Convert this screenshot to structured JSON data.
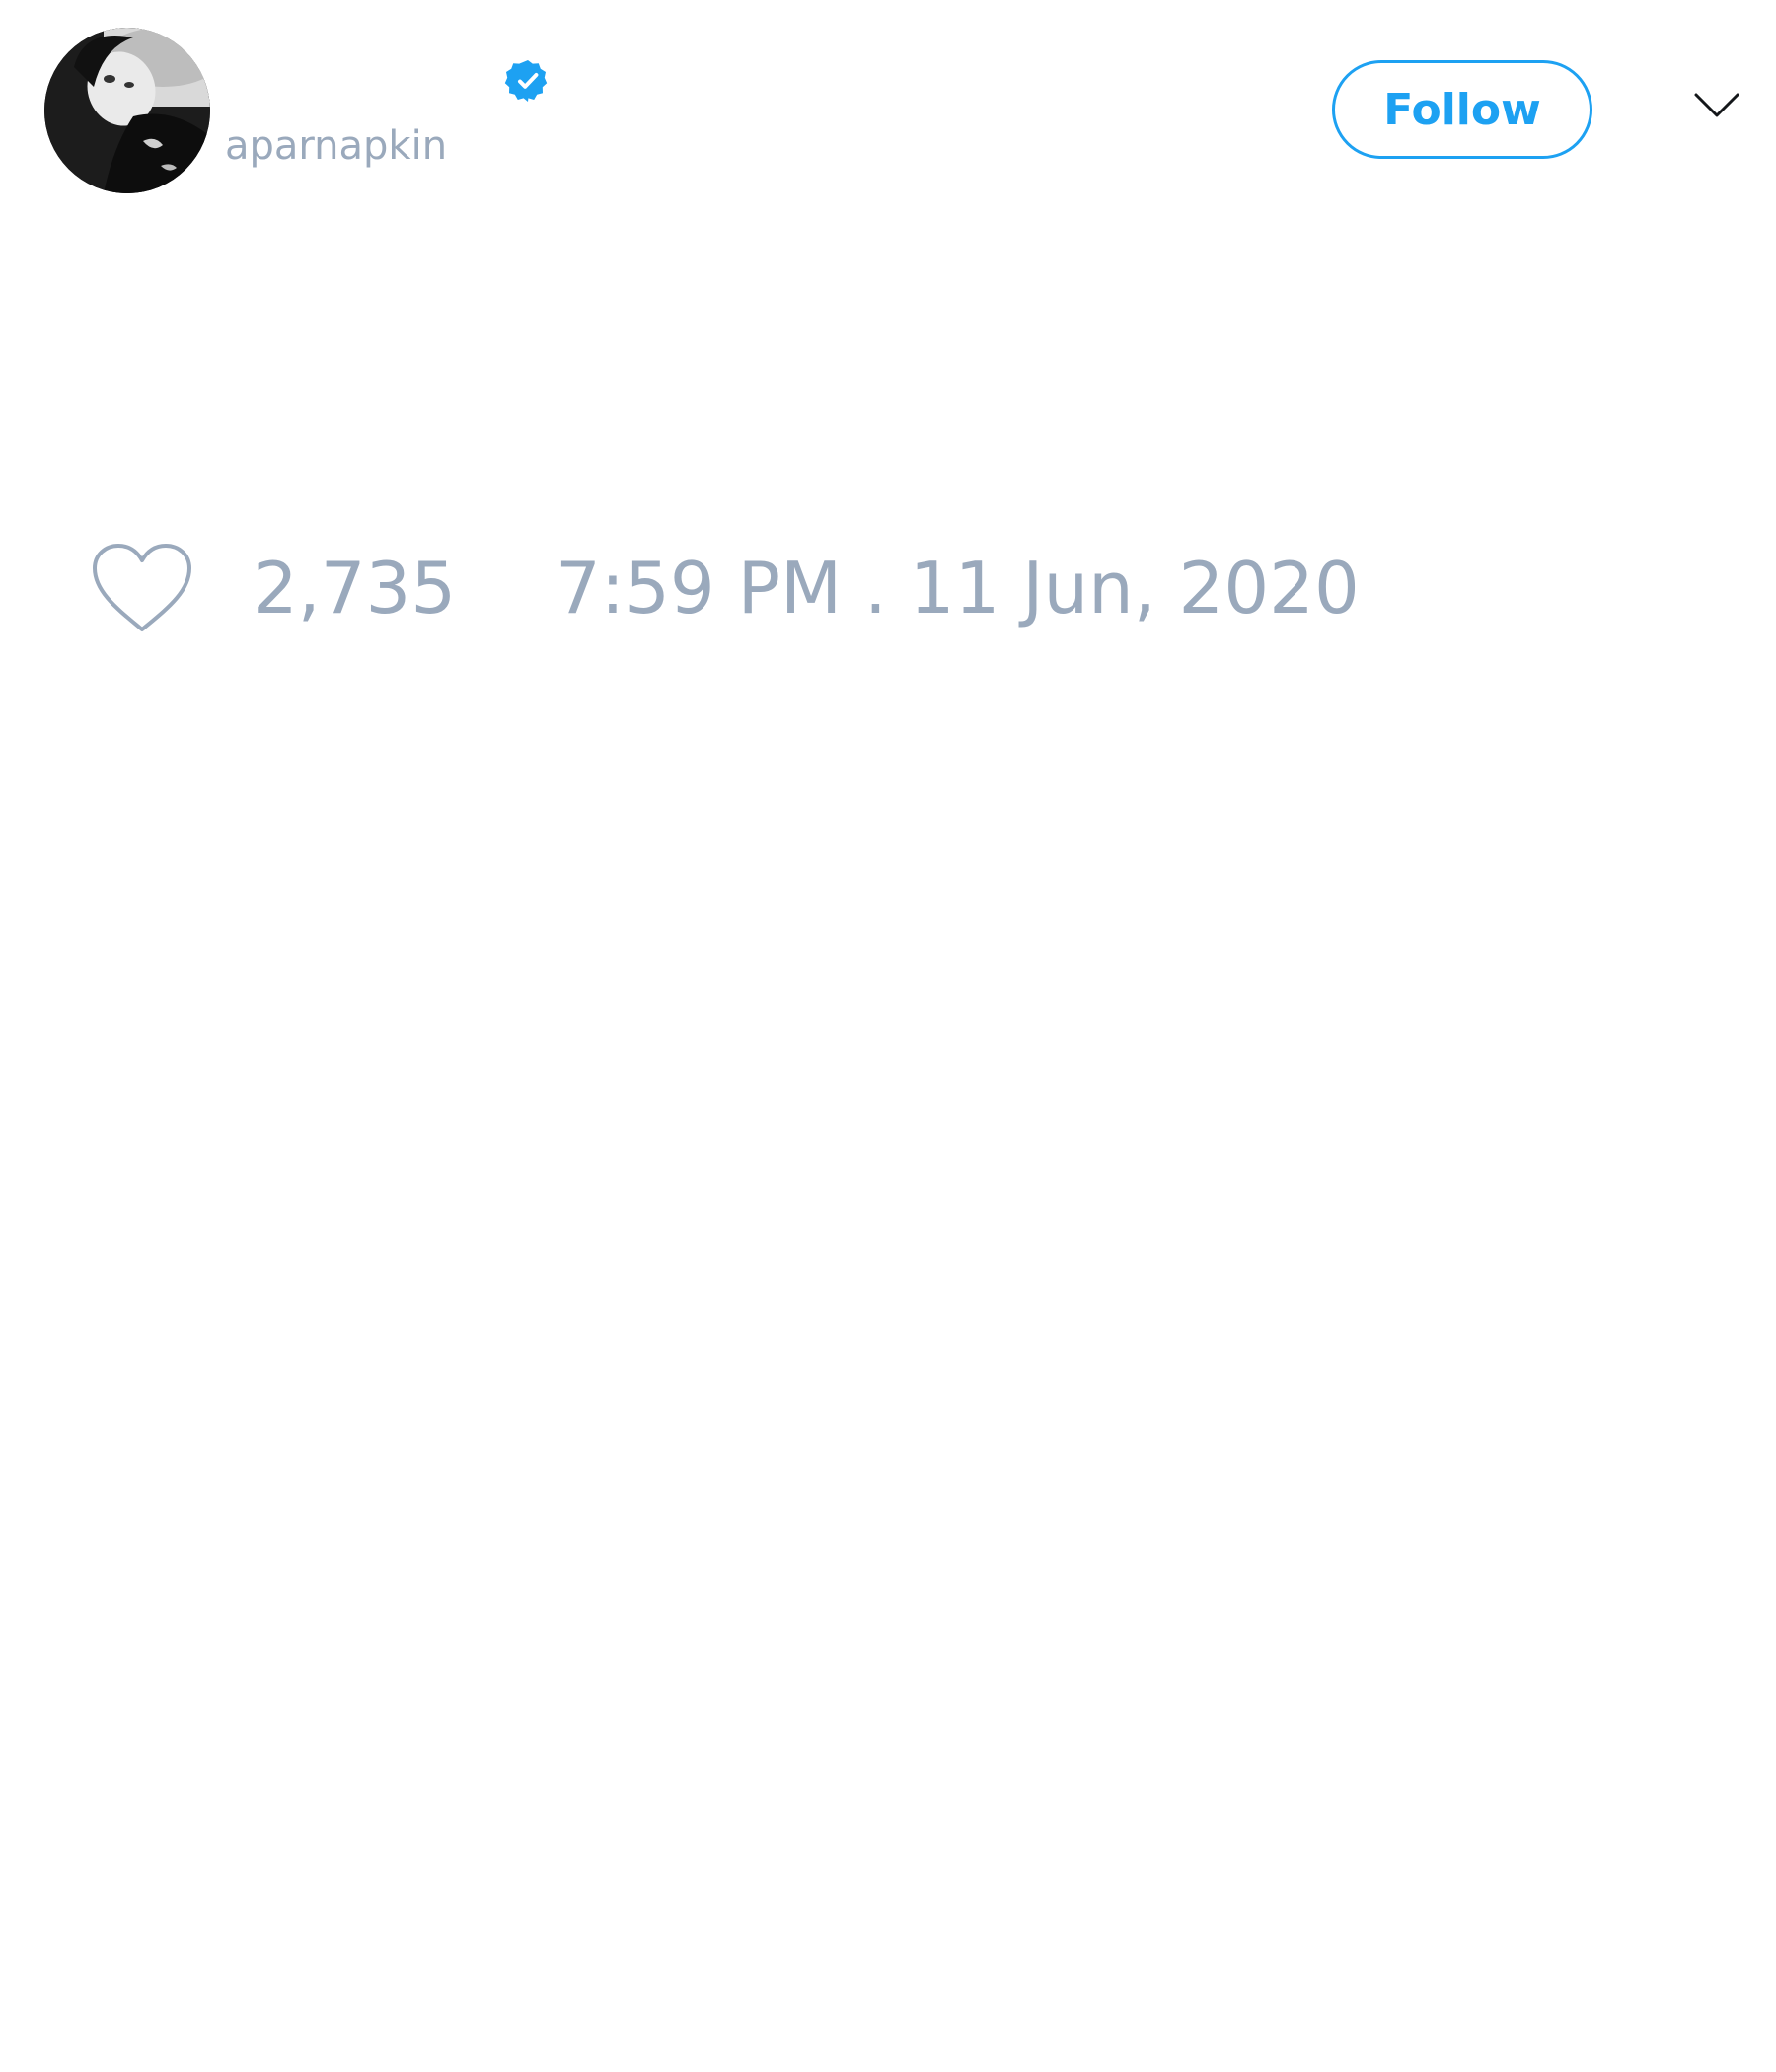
{
  "tweet": {
    "author": {
      "handle": "aparnapkin",
      "verified": true,
      "avatar": "profile-photo"
    },
    "follow_label": "Follow",
    "menu_icon": "chevron-down-icon",
    "like_icon": "heart-icon",
    "like_count": "2,735",
    "timestamp": "7:59 PM . 11 Jun, 2020"
  },
  "colors": {
    "accent": "#1da1f2",
    "muted_text": "#9aa9bc",
    "background": "#ffffff"
  }
}
